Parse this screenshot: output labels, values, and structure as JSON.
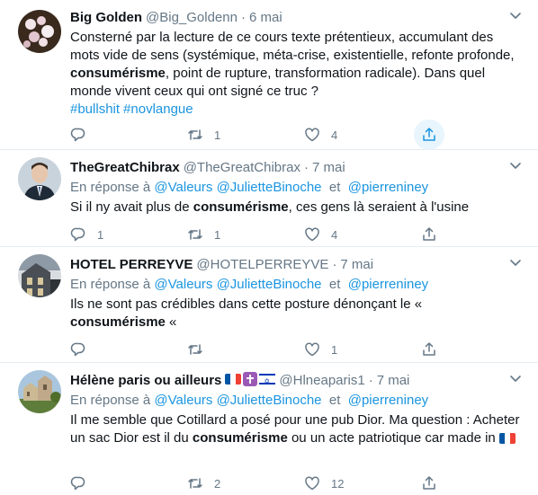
{
  "tweets": [
    {
      "name": "Big Golden",
      "handle": "@Big_Goldenn",
      "date": "6 mai",
      "text_parts": [
        "Consterné par la lecture de ce cours texte prétentieux, accumulant des mots vide de sens (systémique, méta-crise, existentielle, refonte profonde, ",
        "consumérisme",
        ", point de rupture, transformation radicale). Dans quel monde vivent ceux qui ont signé ce truc ?"
      ],
      "hashtags": [
        "#bullshit",
        "#novlangue"
      ],
      "actions": {
        "reply": "",
        "retweet": "1",
        "like": "4"
      }
    },
    {
      "name": "TheGreatChibrax",
      "handle": "@TheGreatChibrax",
      "date": "7 mai",
      "reply_prefix": "En réponse à",
      "reply_mentions": [
        "@Valeurs",
        "@JulietteBinoche"
      ],
      "reply_and": "et",
      "reply_last": "@pierreniney",
      "text_parts": [
        "Si il ny avait plus de ",
        "consumérisme",
        ", ces gens là seraient à l'usine"
      ],
      "actions": {
        "reply": "1",
        "retweet": "1",
        "like": "4"
      }
    },
    {
      "name": "HOTEL PERREYVE",
      "handle": "@HOTELPERREYVE",
      "date": "7 mai",
      "reply_prefix": "En réponse à",
      "reply_mentions": [
        "@Valeurs",
        "@JulietteBinoche"
      ],
      "reply_and": "et",
      "reply_last": "@pierreniney",
      "text_parts": [
        "Ils ne sont pas crédibles dans cette posture dénonçant le « ",
        "consumérisme",
        " «"
      ],
      "actions": {
        "reply": "",
        "retweet": "",
        "like": "1"
      }
    },
    {
      "name": "Hélène paris ou ailleurs",
      "handle": "@Hlneaparis1",
      "date": "7 mai",
      "reply_prefix": "En réponse à",
      "reply_mentions": [
        "@Valeurs",
        "@JulietteBinoche"
      ],
      "reply_and": "et",
      "reply_last": "@pierreniney",
      "text_parts": [
        "Il me semble que Cotillard a posé pour une pub Dior. Ma question : Acheter un sac Dior est il du ",
        "consumérisme",
        " ou un acte patriotique car made in"
      ],
      "actions": {
        "reply": "",
        "retweet": "2",
        "like": "12"
      }
    }
  ],
  "colors": {
    "link": "#1b95e0",
    "muted": "#657786",
    "text": "#0f1419",
    "divider": "#e6ecf0"
  },
  "icons": [
    "reply-icon",
    "retweet-icon",
    "like-icon",
    "share-icon",
    "chevron-down-icon"
  ]
}
